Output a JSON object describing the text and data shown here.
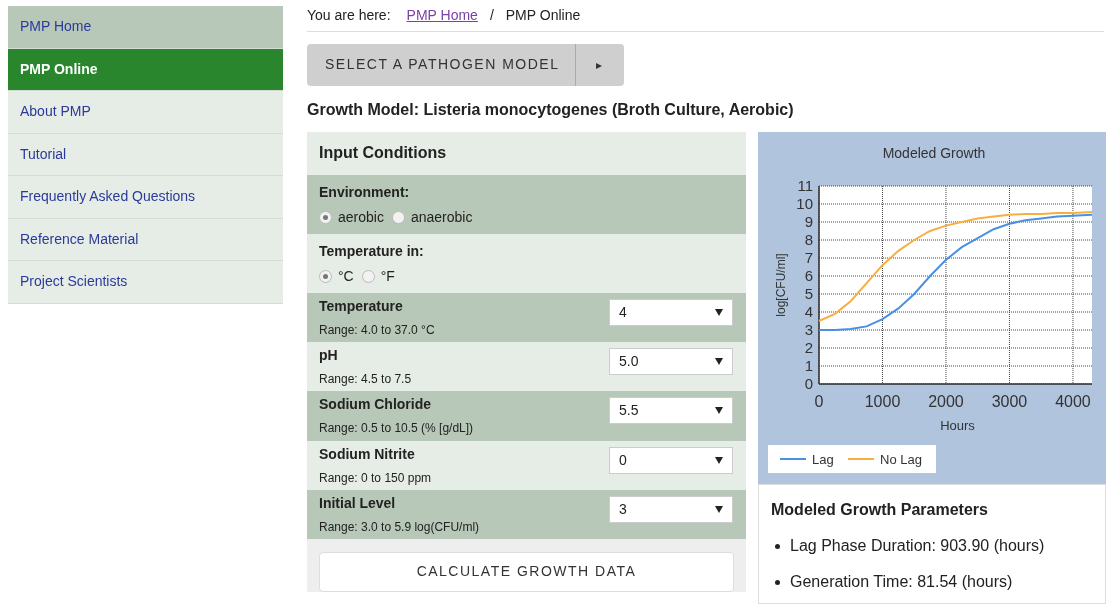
{
  "sidebar": {
    "items": [
      {
        "label": "PMP Home",
        "selected": false,
        "kind": "home"
      },
      {
        "label": "PMP Online",
        "selected": true,
        "kind": "link"
      },
      {
        "label": "About PMP",
        "selected": false,
        "kind": "link"
      },
      {
        "label": "Tutorial",
        "selected": false,
        "kind": "link"
      },
      {
        "label": "Frequently Asked Questions",
        "selected": false,
        "kind": "link"
      },
      {
        "label": "Reference Material",
        "selected": false,
        "kind": "link"
      },
      {
        "label": "Project Scientists",
        "selected": false,
        "kind": "link"
      }
    ]
  },
  "breadcrumb": {
    "prefix": "You are here:",
    "link": "PMP Home",
    "separator": "/",
    "current": "PMP Online"
  },
  "model_button": {
    "label": "SELECT A PATHOGEN MODEL",
    "arrow": "▸"
  },
  "model_title": "Growth Model: Listeria monocytogenes (Broth Culture, Aerobic)",
  "input_conditions": {
    "title": "Input Conditions",
    "radio_groups": [
      {
        "label": "Environment:",
        "options": [
          {
            "label": "aerobic",
            "selected": true
          },
          {
            "label": "anaerobic",
            "selected": false
          }
        ]
      },
      {
        "label": "Temperature in:",
        "options": [
          {
            "label": "°C",
            "selected": true
          },
          {
            "label": "°F",
            "selected": false
          }
        ]
      }
    ],
    "fields": [
      {
        "label": "Temperature",
        "range": "Range: 4.0 to 37.0 °C",
        "value": "4"
      },
      {
        "label": "pH",
        "range": "Range: 4.5 to 7.5",
        "value": "5.0"
      },
      {
        "label": "Sodium Chloride",
        "range": "Range: 0.5 to 10.5 (% [g/dL])",
        "value": "5.5"
      },
      {
        "label": "Sodium Nitrite",
        "range": "Range: 0 to 150 ppm",
        "value": "0"
      },
      {
        "label": "Initial Level",
        "range": "Range: 3.0 to 5.9 log(CFU/ml)",
        "value": "3"
      }
    ],
    "calculate_button": "CALCULATE GROWTH DATA"
  },
  "chart": {
    "chart_data": {
      "type": "line",
      "title": "Modeled Growth",
      "xlabel": "Hours",
      "ylabel": "log[CFU/ml]",
      "x": [
        0,
        250,
        500,
        750,
        1000,
        1250,
        1500,
        1750,
        2000,
        2250,
        2500,
        2750,
        3000,
        3250,
        3500,
        3750,
        4000,
        4300
      ],
      "series": [
        {
          "name": "Lag",
          "color": "#4a90e2",
          "values": [
            3.0,
            3.0,
            3.05,
            3.2,
            3.6,
            4.2,
            5.0,
            6.0,
            6.9,
            7.6,
            8.1,
            8.6,
            8.9,
            9.1,
            9.2,
            9.3,
            9.35,
            9.4
          ]
        },
        {
          "name": "No Lag",
          "color": "#f5b041",
          "values": [
            3.5,
            3.9,
            4.6,
            5.6,
            6.6,
            7.4,
            8.0,
            8.5,
            8.8,
            9.0,
            9.2,
            9.3,
            9.4,
            9.45,
            9.45,
            9.5,
            9.5,
            9.55
          ]
        }
      ],
      "grid": true,
      "legend": true,
      "xlim": [
        0,
        4300
      ],
      "ylim": [
        0,
        11
      ],
      "xticks": [
        {
          "value": 0,
          "label": "0"
        },
        {
          "value": 1000,
          "label": "1000"
        },
        {
          "value": 2000,
          "label": "2000"
        },
        {
          "value": 3000,
          "label": "3000"
        },
        {
          "value": 4000,
          "label": "4000"
        }
      ],
      "yticks": [
        {
          "value": 0,
          "label": "0"
        },
        {
          "value": 1,
          "label": "1"
        },
        {
          "value": 2,
          "label": "2"
        },
        {
          "value": 3,
          "label": "3"
        },
        {
          "value": 4,
          "label": "4"
        },
        {
          "value": 5,
          "label": "5"
        },
        {
          "value": 6,
          "label": "6"
        },
        {
          "value": 7,
          "label": "7"
        },
        {
          "value": 8,
          "label": "8"
        },
        {
          "value": 9,
          "label": "9"
        },
        {
          "value": 10,
          "label": "10"
        },
        {
          "value": 11,
          "label": "11"
        }
      ]
    }
  },
  "parameters": {
    "title": "Modeled Growth Parameters",
    "items": [
      "Lag Phase Duration: 903.90 (hours)",
      "Generation Time: 81.54 (hours)"
    ]
  }
}
